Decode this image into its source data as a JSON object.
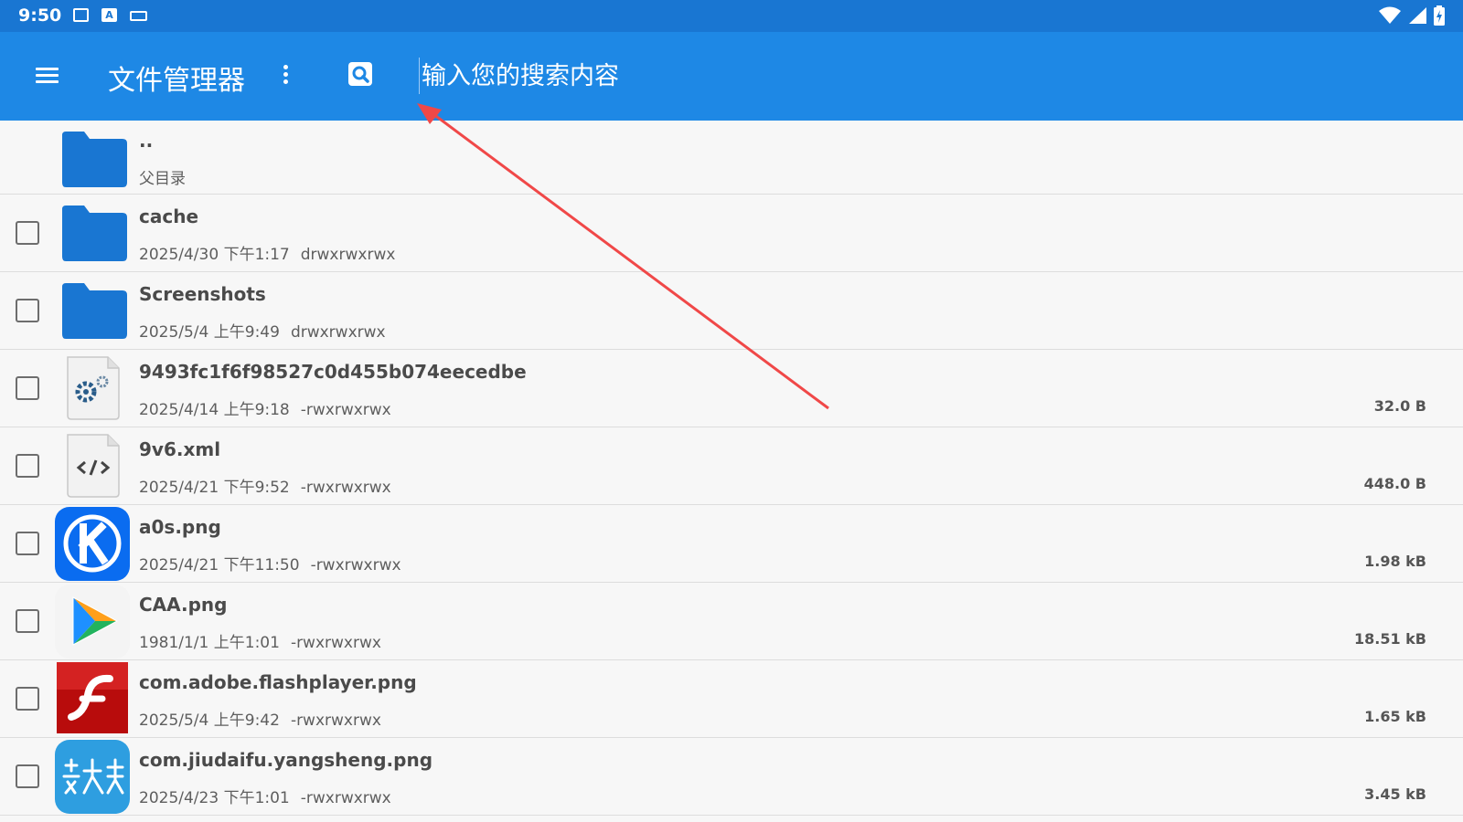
{
  "status_bar": {
    "time": "9:50",
    "left_icons": [
      "image-icon",
      "text-a-icon",
      "keyboard-icon"
    ],
    "right_icons": [
      "wifi-icon",
      "signal-icon",
      "battery-icon"
    ]
  },
  "app_bar": {
    "title": "文件管理器",
    "search_placeholder": "输入您的搜索内容",
    "bg_color": "#1e88e5",
    "status_color": "#1976d2"
  },
  "parent_entry": {
    "name": "..",
    "meta": "父目录"
  },
  "files": [
    {
      "name": "cache",
      "date": "2025/4/30 下午1:17",
      "perm": "drwxrwxrwx",
      "size": "",
      "icon": "folder-icon"
    },
    {
      "name": "Screenshots",
      "date": "2025/5/4 上午9:49",
      "perm": "drwxrwxrwx",
      "size": "",
      "icon": "folder-icon"
    },
    {
      "name": "9493fc1f6f98527c0d455b074eecedbe",
      "date": "2025/4/14 上午9:18",
      "perm": "-rwxrwxrwx",
      "size": "32.0 B",
      "icon": "settings-file-icon"
    },
    {
      "name": "9v6.xml",
      "date": "2025/4/21 下午9:52",
      "perm": "-rwxrwxrwx",
      "size": "448.0 B",
      "icon": "code-file-icon"
    },
    {
      "name": "a0s.png",
      "date": "2025/4/21 下午11:50",
      "perm": "-rwxrwxrwx",
      "size": "1.98 kB",
      "icon": "k-app-icon"
    },
    {
      "name": "CAA.png",
      "date": "1981/1/1 上午1:01",
      "perm": "-rwxrwxrwx",
      "size": "18.51 kB",
      "icon": "play-app-icon"
    },
    {
      "name": "com.adobe.flashplayer.png",
      "date": "2025/5/4 上午9:42",
      "perm": "-rwxrwxrwx",
      "size": "1.65 kB",
      "icon": "flash-app-icon"
    },
    {
      "name": "com.jiudaifu.yangsheng.png",
      "date": "2025/4/23 下午1:01",
      "perm": "-rwxrwxrwx",
      "size": "3.45 kB",
      "icon": "jiudaifu-app-icon"
    }
  ],
  "annotation": {
    "color": "#f04848"
  }
}
